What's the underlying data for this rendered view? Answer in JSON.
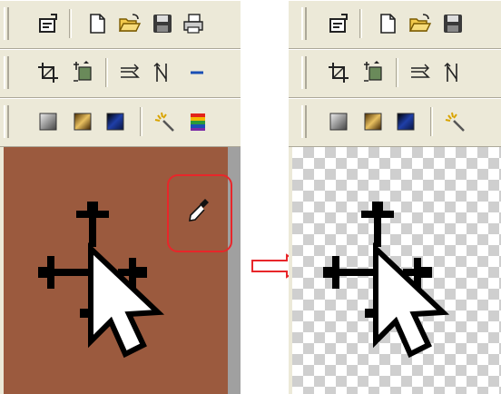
{
  "left_panel": {
    "toolbars": [
      [
        "properties-icon",
        "new-file-icon",
        "open-folder-icon",
        "save-icon",
        "print-icon"
      ],
      [
        "crop-icon",
        "resize-icon",
        "flip-horizontal-icon",
        "flip-vertical-icon",
        "arrow-line-icon"
      ],
      [
        "gray-gradient-icon",
        "gold-gradient-icon",
        "blue-gradient-icon",
        "magic-wand-icon",
        "color-bars-icon"
      ]
    ],
    "canvas_background": "#9b5a3e",
    "tool_highlight_color": "#e8262a"
  },
  "right_panel": {
    "toolbars": [
      [
        "properties-icon",
        "new-file-icon",
        "open-folder-icon",
        "save-icon"
      ],
      [
        "crop-icon",
        "resize-icon",
        "flip-horizontal-icon",
        "flip-vertical-icon"
      ],
      [
        "gray-gradient-icon",
        "gold-gradient-icon",
        "blue-gradient-icon",
        "magic-wand-icon"
      ]
    ],
    "canvas_background": "transparent-checkerboard"
  },
  "connector": {
    "color": "#e8262a",
    "icon": "right-arrow-icon"
  }
}
